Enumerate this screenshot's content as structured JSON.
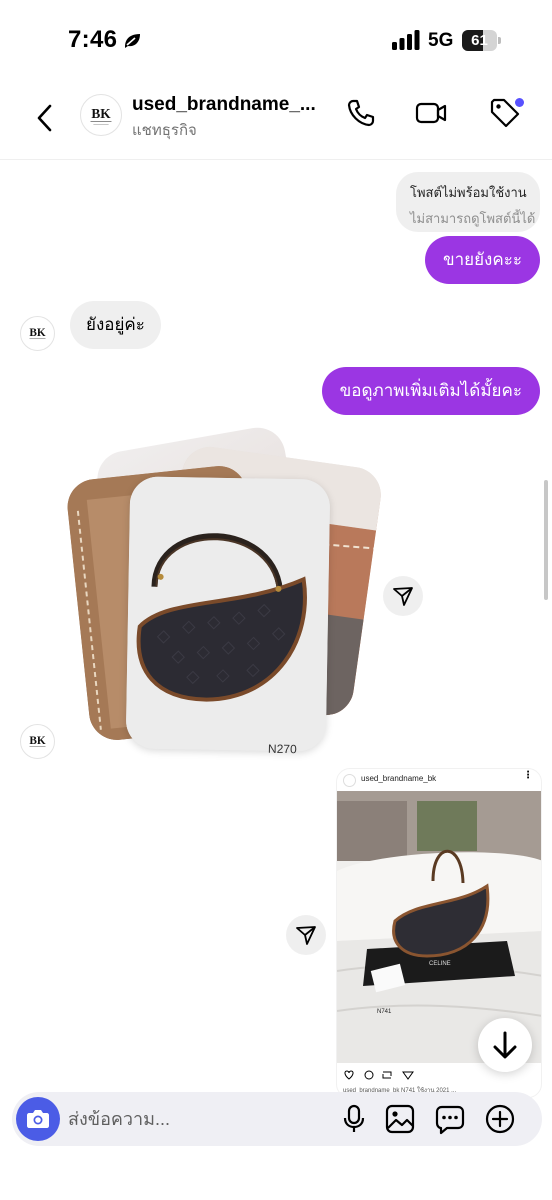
{
  "status": {
    "time": "7:46",
    "network": "5G",
    "battery": "61",
    "battery_level": 0.61
  },
  "header": {
    "name": "used_brandname_...",
    "subtitle": "แชทธุรกิจ"
  },
  "avatar_logo": "BK",
  "messages": {
    "unavailable_title": "โพสต์ไม่พร้อมใช้งาน",
    "unavailable_sub": "ไม่สามารถดูโพสต์นี้ได้",
    "out1": "ขายยังคะะ",
    "in1": "ยังอยู่ค่ะ",
    "out2": "ขอดูภาพเพิ่มเติมได้มั้ยคะ",
    "photo_code": "N270"
  },
  "shared_post": {
    "username": "used_brandname_bk",
    "more": "⋮",
    "code": "N741",
    "brand": "CELINE",
    "caption": "used_brandname_bk N741 ใช้งาน 2021 ..."
  },
  "composer": {
    "placeholder": "ส่งข้อความ..."
  },
  "colors": {
    "accent_bubble": "#9b36e3",
    "camera": "#4b5ce6",
    "notify_dot": "#5851ff"
  }
}
